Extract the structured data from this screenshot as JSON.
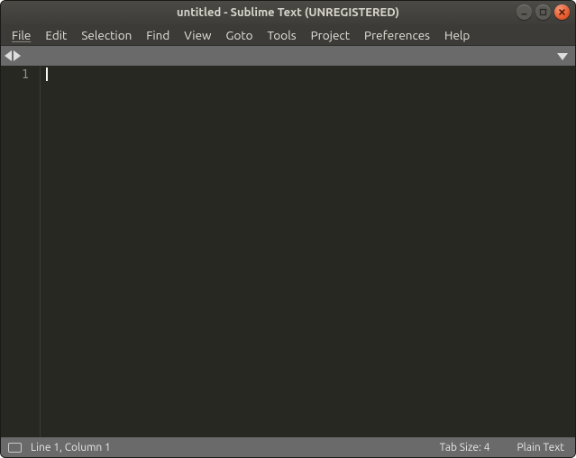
{
  "window": {
    "title": "untitled - Sublime Text (UNREGISTERED)"
  },
  "menubar": {
    "items": [
      "File",
      "Edit",
      "Selection",
      "Find",
      "View",
      "Goto",
      "Tools",
      "Project",
      "Preferences",
      "Help"
    ]
  },
  "editor": {
    "line_numbers": [
      "1"
    ]
  },
  "statusbar": {
    "position": "Line 1, Column 1",
    "tab_size": "Tab Size: 4",
    "syntax": "Plain Text"
  }
}
